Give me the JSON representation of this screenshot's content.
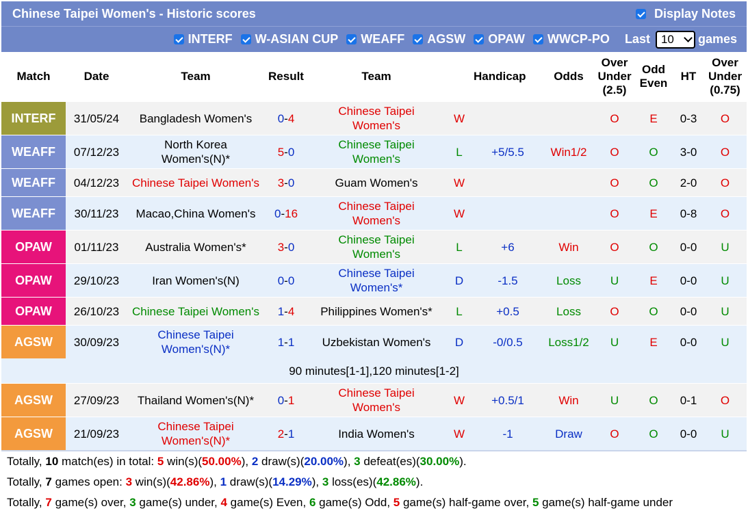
{
  "title": "Chinese Taipei Women's - Historic scores",
  "display_notes": {
    "label": "Display Notes",
    "checked": true
  },
  "filters": [
    {
      "label": "INTERF",
      "checked": true
    },
    {
      "label": "W-ASIAN CUP",
      "checked": true
    },
    {
      "label": "WEAFF",
      "checked": true
    },
    {
      "label": "AGSW",
      "checked": true
    },
    {
      "label": "OPAW",
      "checked": true
    },
    {
      "label": "WWCP-PO",
      "checked": true
    }
  ],
  "last_label": "Last",
  "last_value": "10",
  "games_label": "games",
  "headers": {
    "match": "Match",
    "date": "Date",
    "team1": "Team",
    "result": "Result",
    "team2": "Team",
    "handicap": "Handicap",
    "odds": "Odds",
    "over_under_25": "Over Under (2.5)",
    "odd_even": "Odd Even",
    "ht": "HT",
    "over_under_075": "Over Under (0.75)"
  },
  "colors": {
    "INTERF": "#9c9b3a",
    "WEAFF": "#7b8fd0",
    "OPAW": "#e7137a",
    "AGSW": "#f39a3d",
    "header_bar": "#6f87c8",
    "red": "#e00000",
    "blue": "#0a2fc4",
    "green": "#008a00"
  },
  "rows": [
    {
      "match": "INTERF",
      "date": "31/05/24",
      "team1": "Bangladesh Women's",
      "t1c": "",
      "s1": "0",
      "s2": "4",
      "team2a": "Chinese Taipei",
      "team2b": "Women's",
      "t2c": "red",
      "wld": "W",
      "hcp": "",
      "odds": "",
      "oddsc": "",
      "ou": "O",
      "oe": "E",
      "ht": "0-3",
      "ou2": "O"
    },
    {
      "match": "WEAFF",
      "date": "07/12/23",
      "team1": "North Korea",
      "team1b": "Women's(N)*",
      "t1c": "",
      "s1": "5",
      "s2": "0",
      "team2a": "Chinese Taipei",
      "team2b": "Women's",
      "t2c": "green",
      "wld": "L",
      "hcp": "+5/5.5",
      "odds": "Win1/2",
      "oddsc": "red",
      "ou": "O",
      "oe": "O",
      "ht": "3-0",
      "ou2": "O"
    },
    {
      "match": "WEAFF",
      "date": "04/12/23",
      "team1": "Chinese Taipei Women's",
      "t1c": "red",
      "s1": "3",
      "s2": "0",
      "team2a": "Guam Women's",
      "team2b": "",
      "t2c": "",
      "wld": "W",
      "hcp": "",
      "odds": "",
      "oddsc": "",
      "ou": "O",
      "oe": "O",
      "ht": "2-0",
      "ou2": "O",
      "short": true
    },
    {
      "match": "WEAFF",
      "date": "30/11/23",
      "team1": "Macao,China Women's",
      "t1c": "",
      "s1": "0",
      "s2": "16",
      "team2a": "Chinese Taipei",
      "team2b": "Women's",
      "t2c": "red",
      "wld": "W",
      "hcp": "",
      "odds": "",
      "oddsc": "",
      "ou": "O",
      "oe": "E",
      "ht": "0-8",
      "ou2": "O"
    },
    {
      "match": "OPAW",
      "date": "01/11/23",
      "team1": "Australia Women's*",
      "t1c": "",
      "s1": "3",
      "s2": "0",
      "team2a": "Chinese Taipei",
      "team2b": "Women's",
      "t2c": "green",
      "wld": "L",
      "hcp": "+6",
      "odds": "Win",
      "oddsc": "red",
      "ou": "O",
      "oe": "O",
      "ht": "0-0",
      "ou2": "U"
    },
    {
      "match": "OPAW",
      "date": "29/10/23",
      "team1": "Iran Women's(N)",
      "t1c": "",
      "s1": "0",
      "s2": "0",
      "team2a": "Chinese Taipei",
      "team2b": "Women's*",
      "t2c": "blue",
      "wld": "D",
      "hcp": "-1.5",
      "odds": "Loss",
      "oddsc": "green",
      "ou": "U",
      "oe": "E",
      "ht": "0-0",
      "ou2": "U"
    },
    {
      "match": "OPAW",
      "date": "26/10/23",
      "team1": "Chinese Taipei Women's",
      "t1c": "green",
      "s1": "1",
      "s2": "4",
      "team2a": "Philippines Women's*",
      "team2b": "",
      "t2c": "",
      "wld": "L",
      "hcp": "+0.5",
      "odds": "Loss",
      "oddsc": "green",
      "ou": "O",
      "oe": "O",
      "ht": "0-0",
      "ou2": "U",
      "short": true
    },
    {
      "match": "AGSW",
      "date": "30/09/23",
      "team1": "Chinese Taipei",
      "team1b": "Women's(N)*",
      "t1c": "blue",
      "s1": "1",
      "s2": "1",
      "team2a": "Uzbekistan Women's",
      "team2b": "",
      "t2c": "",
      "wld": "D",
      "hcp": "-0/0.5",
      "odds": "Loss1/2",
      "oddsc": "green",
      "ou": "U",
      "oe": "E",
      "ht": "0-0",
      "ou2": "U"
    },
    {
      "match": "AGSW",
      "date": "27/09/23",
      "team1": "Thailand Women's(N)*",
      "t1c": "",
      "s1": "0",
      "s2": "1",
      "team2a": "Chinese Taipei",
      "team2b": "Women's",
      "t2c": "red",
      "wld": "W",
      "hcp": "+0.5/1",
      "odds": "Win",
      "oddsc": "red",
      "ou": "U",
      "oe": "O",
      "ht": "0-1",
      "ou2": "O"
    },
    {
      "match": "AGSW",
      "date": "21/09/23",
      "team1": "Chinese Taipei",
      "team1b": "Women's(N)*",
      "t1c": "red",
      "s1": "2",
      "s2": "1",
      "team2a": "India Women's",
      "team2b": "",
      "t2c": "",
      "wld": "W",
      "hcp": "-1",
      "odds": "Draw",
      "oddsc": "blue",
      "ou": "O",
      "oe": "O",
      "ht": "0-0",
      "ou2": "U"
    }
  ],
  "note_row": "90 minutes[1-1],120 minutes[1-2]",
  "summary": {
    "line1": [
      "Totally, ",
      "10",
      " match(es) in total: ",
      "5",
      " win(s)(",
      "50.00%",
      "), ",
      "2",
      " draw(s)(",
      "20.00%",
      "), ",
      "3",
      " defeat(es)(",
      "30.00%",
      ")."
    ],
    "line2": [
      "Totally, ",
      "7",
      " games open: ",
      "3",
      " win(s)(",
      "42.86%",
      "), ",
      "1",
      " draw(s)(",
      "14.29%",
      "), ",
      "3",
      " loss(es)(",
      "42.86%",
      ")."
    ],
    "line3": [
      "Totally, ",
      "7",
      " game(s) over, ",
      "3",
      " game(s) under, ",
      "4",
      " game(s) Even, ",
      "6",
      " game(s) Odd, ",
      "5",
      " game(s) half-game over, ",
      "5",
      " game(s) half-game under"
    ]
  }
}
